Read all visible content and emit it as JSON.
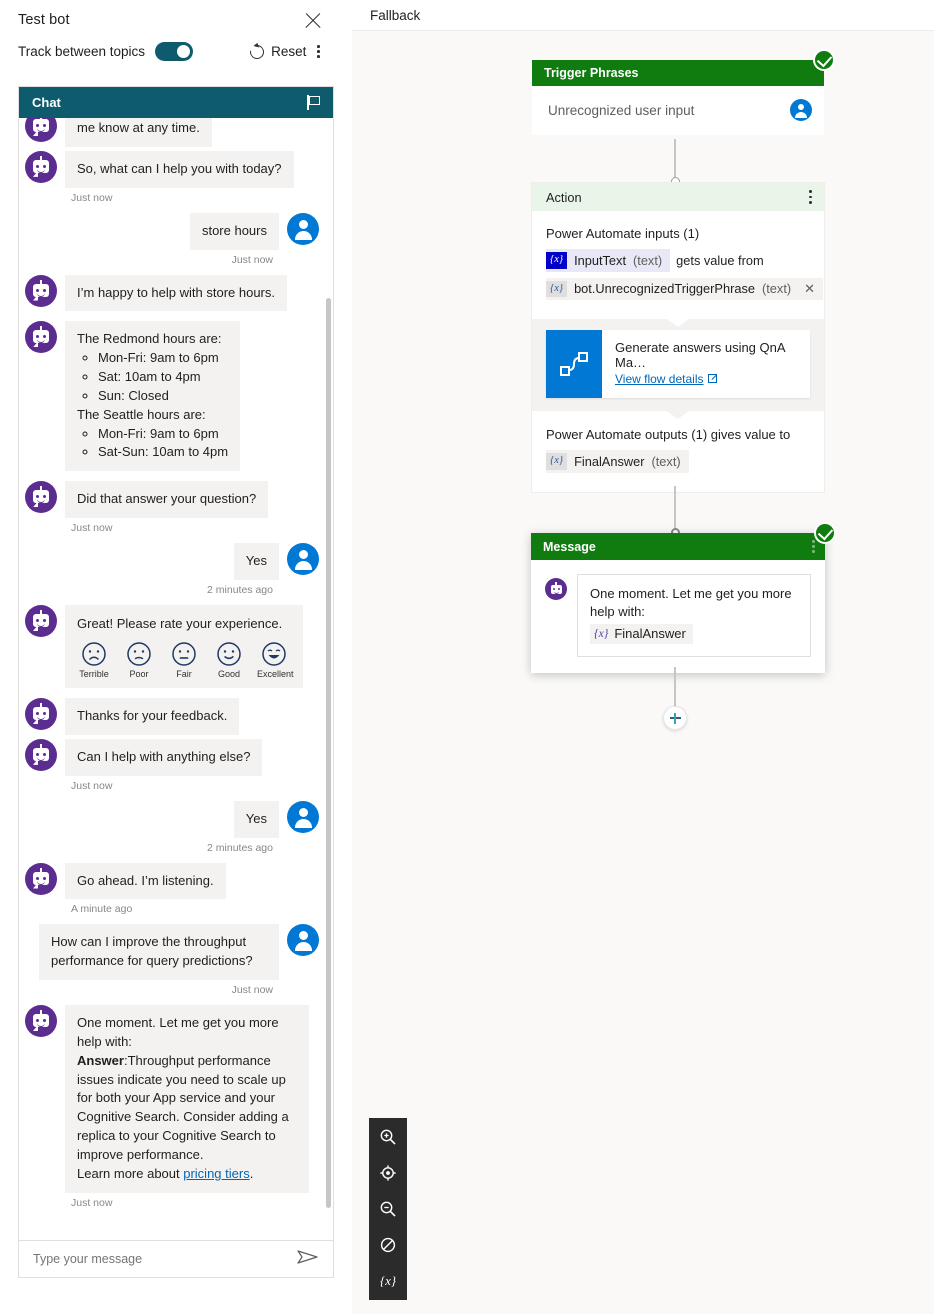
{
  "testbot": {
    "title": "Test bot",
    "close_icon": "close-icon",
    "track_label": "Track between topics",
    "track_on": true,
    "reset_label": "Reset",
    "reset_icon": "refresh-icon",
    "more_icon": "kebab-icon",
    "chat_header": "Chat",
    "flag_icon": "flag-icon",
    "input_placeholder": "Type your message",
    "send_icon": "send-icon",
    "messages": [
      {
        "from": "bot",
        "text": "me know at any time.",
        "partial": true
      },
      {
        "from": "bot",
        "text": "So, what can I help you with today?",
        "ts": "Just now"
      },
      {
        "from": "user",
        "text": "store hours",
        "ts": "Just now"
      },
      {
        "from": "bot",
        "text": "I’m happy to help with store hours."
      },
      {
        "from": "bot",
        "type": "hours"
      },
      {
        "from": "bot",
        "text": "Did that answer your question?",
        "ts": "Just now"
      },
      {
        "from": "user",
        "text": "Yes",
        "ts": "2 minutes ago"
      },
      {
        "from": "bot",
        "type": "rating"
      },
      {
        "from": "bot",
        "text": "Thanks for your feedback."
      },
      {
        "from": "bot",
        "text": "Can I help with anything else?",
        "ts": "Just now"
      },
      {
        "from": "user",
        "text": "Yes",
        "ts": "2 minutes ago"
      },
      {
        "from": "bot",
        "text": "Go ahead. I’m listening.",
        "ts": "A minute ago"
      },
      {
        "from": "user",
        "text": "How can I improve the throughput performance for query predictions?",
        "ts": "Just now"
      },
      {
        "from": "bot",
        "type": "answer",
        "ts": "Just now"
      }
    ],
    "hours": {
      "redmond_title": "The Redmond hours are:",
      "redmond": [
        "Mon-Fri: 9am to 6pm",
        "Sat: 10am to 4pm",
        "Sun: Closed"
      ],
      "seattle_title": "The Seattle hours are:",
      "seattle": [
        "Mon-Fri: 9am to 6pm",
        "Sat-Sun: 10am to 4pm"
      ]
    },
    "rating": {
      "title": "Great! Please rate your experience.",
      "options": [
        "Terrible",
        "Poor",
        "Fair",
        "Good",
        "Excellent"
      ]
    },
    "answer": {
      "line1": "One moment. Let me get you more help with:",
      "label": "Answer",
      "colon": ":",
      "body": "Throughput performance issues indicate you need to scale up for both your App service and your Cognitive Search. Consider adding a replica to your Cognitive Search to improve performance.",
      "learn_prefix": "Learn more about ",
      "learn_link": "pricing tiers",
      "learn_suffix": "."
    }
  },
  "canvas": {
    "title": "Fallback",
    "trigger_node": {
      "header": "Trigger Phrases",
      "status_icon": "check-circle-icon",
      "text": "Unrecognized user input",
      "user_icon": "user-icon"
    },
    "action_node": {
      "header": "Action",
      "more_icon": "kebab-icon",
      "inputs_label": "Power Automate inputs (1)",
      "input_var": "InputText",
      "input_var_type": "(text)",
      "gets_value_from": "gets value from",
      "source_var": "bot.UnrecognizedTriggerPhrase",
      "source_var_type": "(text)",
      "remove_icon": "close-icon",
      "flow_title": "Generate answers using QnA Ma…",
      "flow_link": "View flow details",
      "flow_link_icon": "external-link-icon",
      "flow_icon": "power-automate-icon",
      "outputs_label": "Power Automate outputs (1) gives value to",
      "output_var": "FinalAnswer",
      "output_var_type": "(text)"
    },
    "message_node": {
      "header": "Message",
      "status_icon": "check-circle-icon",
      "more_icon": "kebab-icon",
      "bot_icon": "bot-avatar-icon",
      "text": "One moment. Let me get you more help with:",
      "variable": "FinalAnswer",
      "variable_brace": "{x}"
    },
    "add_node_icon": "plus-icon",
    "toolbar": [
      {
        "icon": "zoom-in-icon",
        "name": "zoom-in"
      },
      {
        "icon": "fit-to-screen-icon",
        "name": "fit-to-screen"
      },
      {
        "icon": "zoom-out-icon",
        "name": "zoom-out"
      },
      {
        "icon": "no-entry-icon",
        "name": "disable"
      },
      {
        "icon": "variables-icon",
        "name": "variables",
        "label": "{x}"
      }
    ]
  },
  "colors": {
    "teal": "#0f5b6e",
    "green": "#107c10",
    "light_green": "#eaf5ea",
    "blue": "#0078d4",
    "purple": "#5c2d91",
    "link": "#0067b8"
  }
}
